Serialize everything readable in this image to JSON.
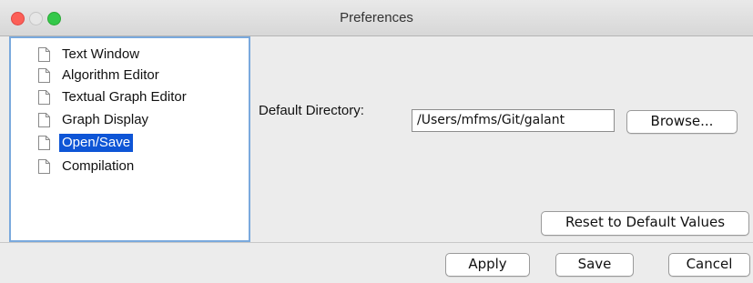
{
  "window": {
    "title": "Preferences"
  },
  "tree": {
    "items": [
      {
        "label": "Text Window",
        "selected": false
      },
      {
        "label": "Algorithm Editor",
        "selected": false
      },
      {
        "label": "Textual Graph Editor",
        "selected": false
      },
      {
        "label": "Graph Display",
        "selected": false
      },
      {
        "label": "Open/Save",
        "selected": true
      },
      {
        "label": "Compilation",
        "selected": false
      }
    ],
    "selection_color": "#0e55d6"
  },
  "panel": {
    "default_directory_label": "Default Directory:",
    "default_directory_value": "/Users/mfms/Git/galant",
    "browse_label": "Browse...",
    "reset_label": "Reset to Default Values"
  },
  "footer": {
    "apply_label": "Apply",
    "save_label": "Save",
    "cancel_label": "Cancel"
  }
}
